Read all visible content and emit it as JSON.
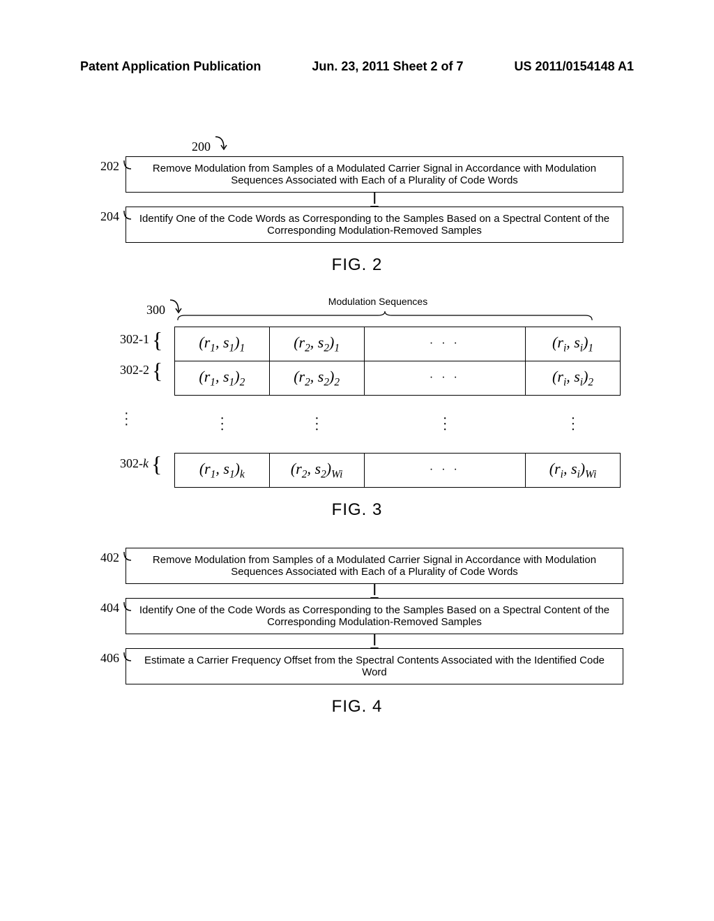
{
  "header": {
    "left": "Patent Application Publication",
    "center": "Jun. 23, 2011  Sheet 2 of 7",
    "right": "US 2011/0154148 A1"
  },
  "fig2": {
    "ref": "200",
    "box1_ref": "202",
    "box1_text": "Remove Modulation from Samples of a Modulated Carrier Signal in Accordance with Modulation Sequences Associated with Each of a Plurality of Code Words",
    "box2_ref": "204",
    "box2_text": "Identify One of the Code Words as Corresponding to the Samples Based on a Spectral Content of the Corresponding Modulation-Removed Samples",
    "label": "FIG. 2"
  },
  "fig3": {
    "ref": "300",
    "title": "Modulation Sequences",
    "row1_ref": "302-1",
    "row2_ref": "302-2",
    "rowk_ref": "302-k",
    "label": "FIG. 3"
  },
  "fig4": {
    "box1_ref": "402",
    "box1_text": "Remove Modulation from Samples of a Modulated Carrier Signal in Accordance with Modulation Sequences Associated with Each of a Plurality of Code Words",
    "box2_ref": "404",
    "box2_text": "Identify One of the Code Words as Corresponding to the Samples Based on a Spectral Content of the Corresponding Modulation-Removed Samples",
    "box3_ref": "406",
    "box3_text": "Estimate a Carrier Frequency Offset from the Spectral Contents Associated with the Identified Code Word",
    "label": "FIG. 4"
  }
}
